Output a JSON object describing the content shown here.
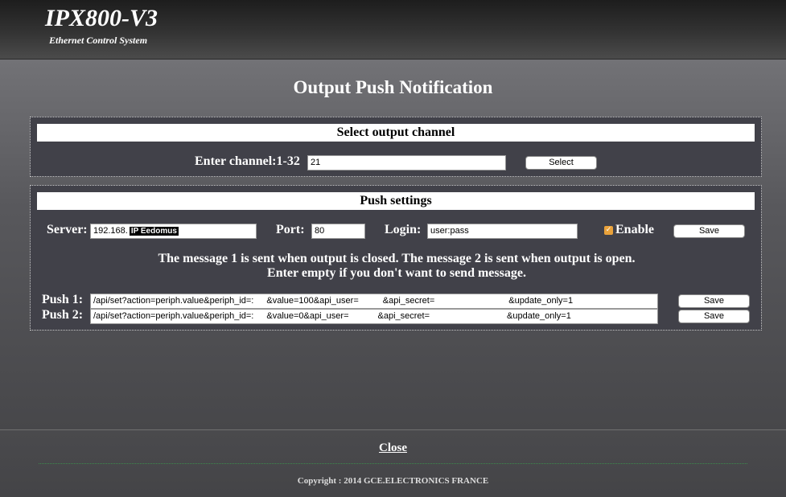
{
  "header": {
    "title": "IPX800-V3",
    "subtitle": "Ethernet Control System"
  },
  "page_title": "Output Push Notification",
  "select_panel": {
    "heading": "Select output channel",
    "channel_label": "Enter channel:1-32",
    "channel_value": "21",
    "select_button": "Select"
  },
  "push_panel": {
    "heading": "Push settings",
    "server_label": "Server:",
    "server_value": "192.168.",
    "server_overlay": "IP Eedomus",
    "port_label": "Port:",
    "port_value": "80",
    "login_label": "Login:",
    "login_value": "user:pass",
    "enable_label": "Enable",
    "enable_checked": true,
    "save_label": "Save",
    "message_line1": "The message 1 is sent when output is closed. The message 2 is sent when output is open.",
    "message_line2": "Enter empty if you don't want to send message.",
    "push1_label": "Push 1:",
    "push1_part1": "/api/set?action=periph.value&periph_id=:",
    "push1_part2": "&value=100&api_user=",
    "push1_part3": "&api_secret=",
    "push1_part4": "&update_only=1",
    "push2_label": "Push 2:",
    "push2_part1": "/api/set?action=periph.value&periph_id=:",
    "push2_part2": "&value=0&api_user=",
    "push2_part3": "&api_secret=",
    "push2_part4": "&update_only=1",
    "push1_save": "Save",
    "push2_save": "Save"
  },
  "footer": {
    "close_label": "Close",
    "copyright": "Copyright : 2014 GCE.ELECTRONICS FRANCE"
  },
  "colors": {
    "accent_checkbox": "#e9a23b",
    "panel_background": "#414149"
  }
}
